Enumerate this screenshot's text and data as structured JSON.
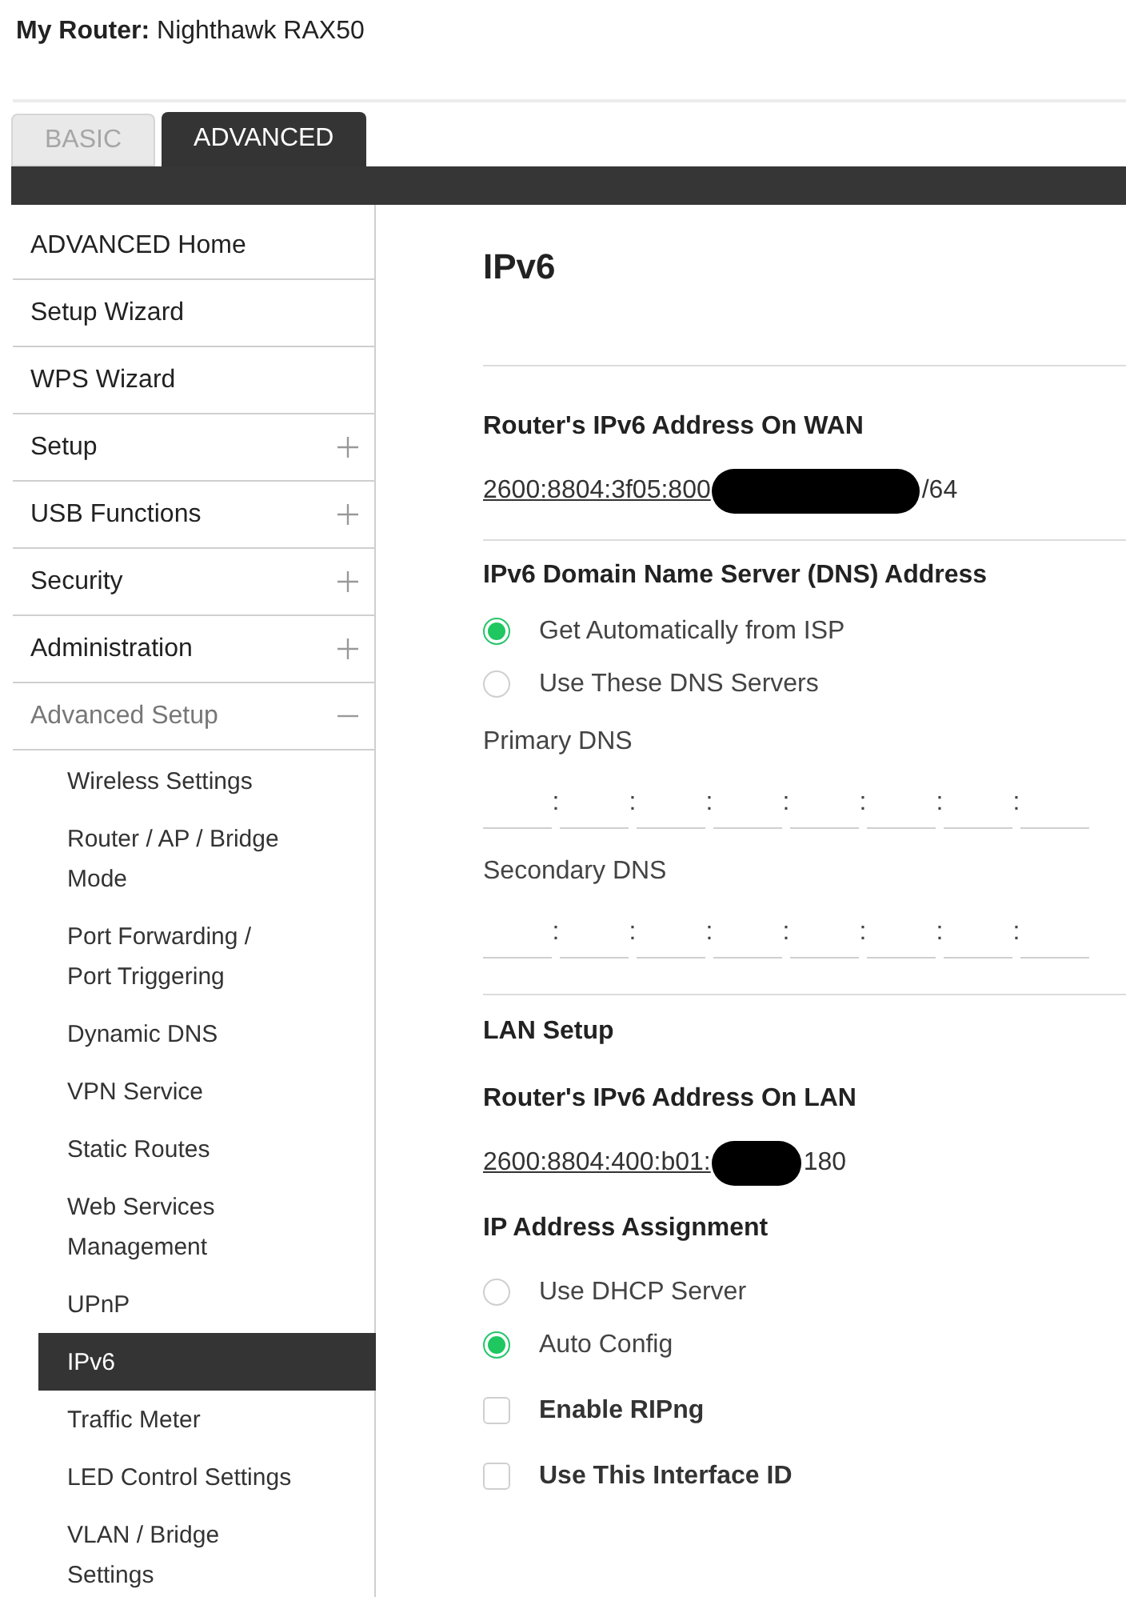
{
  "header": {
    "label": "My Router:",
    "value": "Nighthawk RAX50"
  },
  "tabs": [
    {
      "label": "BASIC",
      "selected": false
    },
    {
      "label": "ADVANCED",
      "selected": true
    }
  ],
  "sidebar": {
    "items": [
      {
        "label": "ADVANCED Home",
        "kind": "link",
        "selected": false
      },
      {
        "label": "Setup Wizard",
        "kind": "link",
        "selected": false
      },
      {
        "label": "WPS Wizard",
        "kind": "link",
        "selected": false
      },
      {
        "label": "Setup",
        "kind": "group",
        "selected": false,
        "expanded": false
      },
      {
        "label": "USB Functions",
        "kind": "group",
        "selected": false,
        "expanded": false
      },
      {
        "label": "Security",
        "kind": "group",
        "selected": false,
        "expanded": false
      },
      {
        "label": "Administration",
        "kind": "group",
        "selected": false,
        "expanded": false
      },
      {
        "label": "Advanced Setup",
        "kind": "group",
        "selected": false,
        "expanded": true,
        "children": [
          {
            "label": "Wireless Settings",
            "selected": false
          },
          {
            "label": "Router / AP / Bridge Mode",
            "selected": false
          },
          {
            "label": "Port Forwarding / Port Triggering",
            "selected": false
          },
          {
            "label": "Dynamic DNS",
            "selected": false
          },
          {
            "label": "VPN Service",
            "selected": false
          },
          {
            "label": "Static Routes",
            "selected": false
          },
          {
            "label": "Web Services Management",
            "selected": false
          },
          {
            "label": "UPnP",
            "selected": false
          },
          {
            "label": "IPv6",
            "selected": true
          },
          {
            "label": "Traffic Meter",
            "selected": false
          },
          {
            "label": "LED Control Settings",
            "selected": false
          },
          {
            "label": "VLAN / Bridge Settings",
            "selected": false
          }
        ]
      }
    ]
  },
  "main": {
    "title": "IPv6",
    "wan": {
      "heading": "Router's IPv6 Address On WAN",
      "address_start": "2600:8804:3f05:800",
      "address_end": "/64"
    },
    "dns": {
      "heading": "IPv6 Domain Name Server (DNS) Address",
      "options": [
        {
          "label": "Get Automatically from ISP",
          "selected": true
        },
        {
          "label": "Use These DNS Servers",
          "selected": false
        }
      ],
      "primary": {
        "label": "Primary DNS",
        "separators": [
          ":",
          ":",
          ":",
          ":",
          ":",
          ":",
          ":"
        ]
      },
      "secondary": {
        "label": "Secondary DNS",
        "separators": [
          ":",
          ":",
          ":",
          ":",
          ":",
          ":",
          ":"
        ]
      }
    },
    "lan": {
      "heading": "LAN Setup",
      "address_label": "Router's IPv6 Address On LAN",
      "address_start": "2600:8804:400:b01:",
      "address_end": "180",
      "assignment_label": "IP Address Assignment",
      "options": [
        {
          "label": "Use DHCP Server",
          "selected": false
        },
        {
          "label": "Auto Config",
          "selected": true
        }
      ],
      "checkboxes": [
        {
          "label": "Enable RIPng",
          "checked": false
        },
        {
          "label": "Use This Interface ID",
          "checked": false
        }
      ]
    }
  }
}
